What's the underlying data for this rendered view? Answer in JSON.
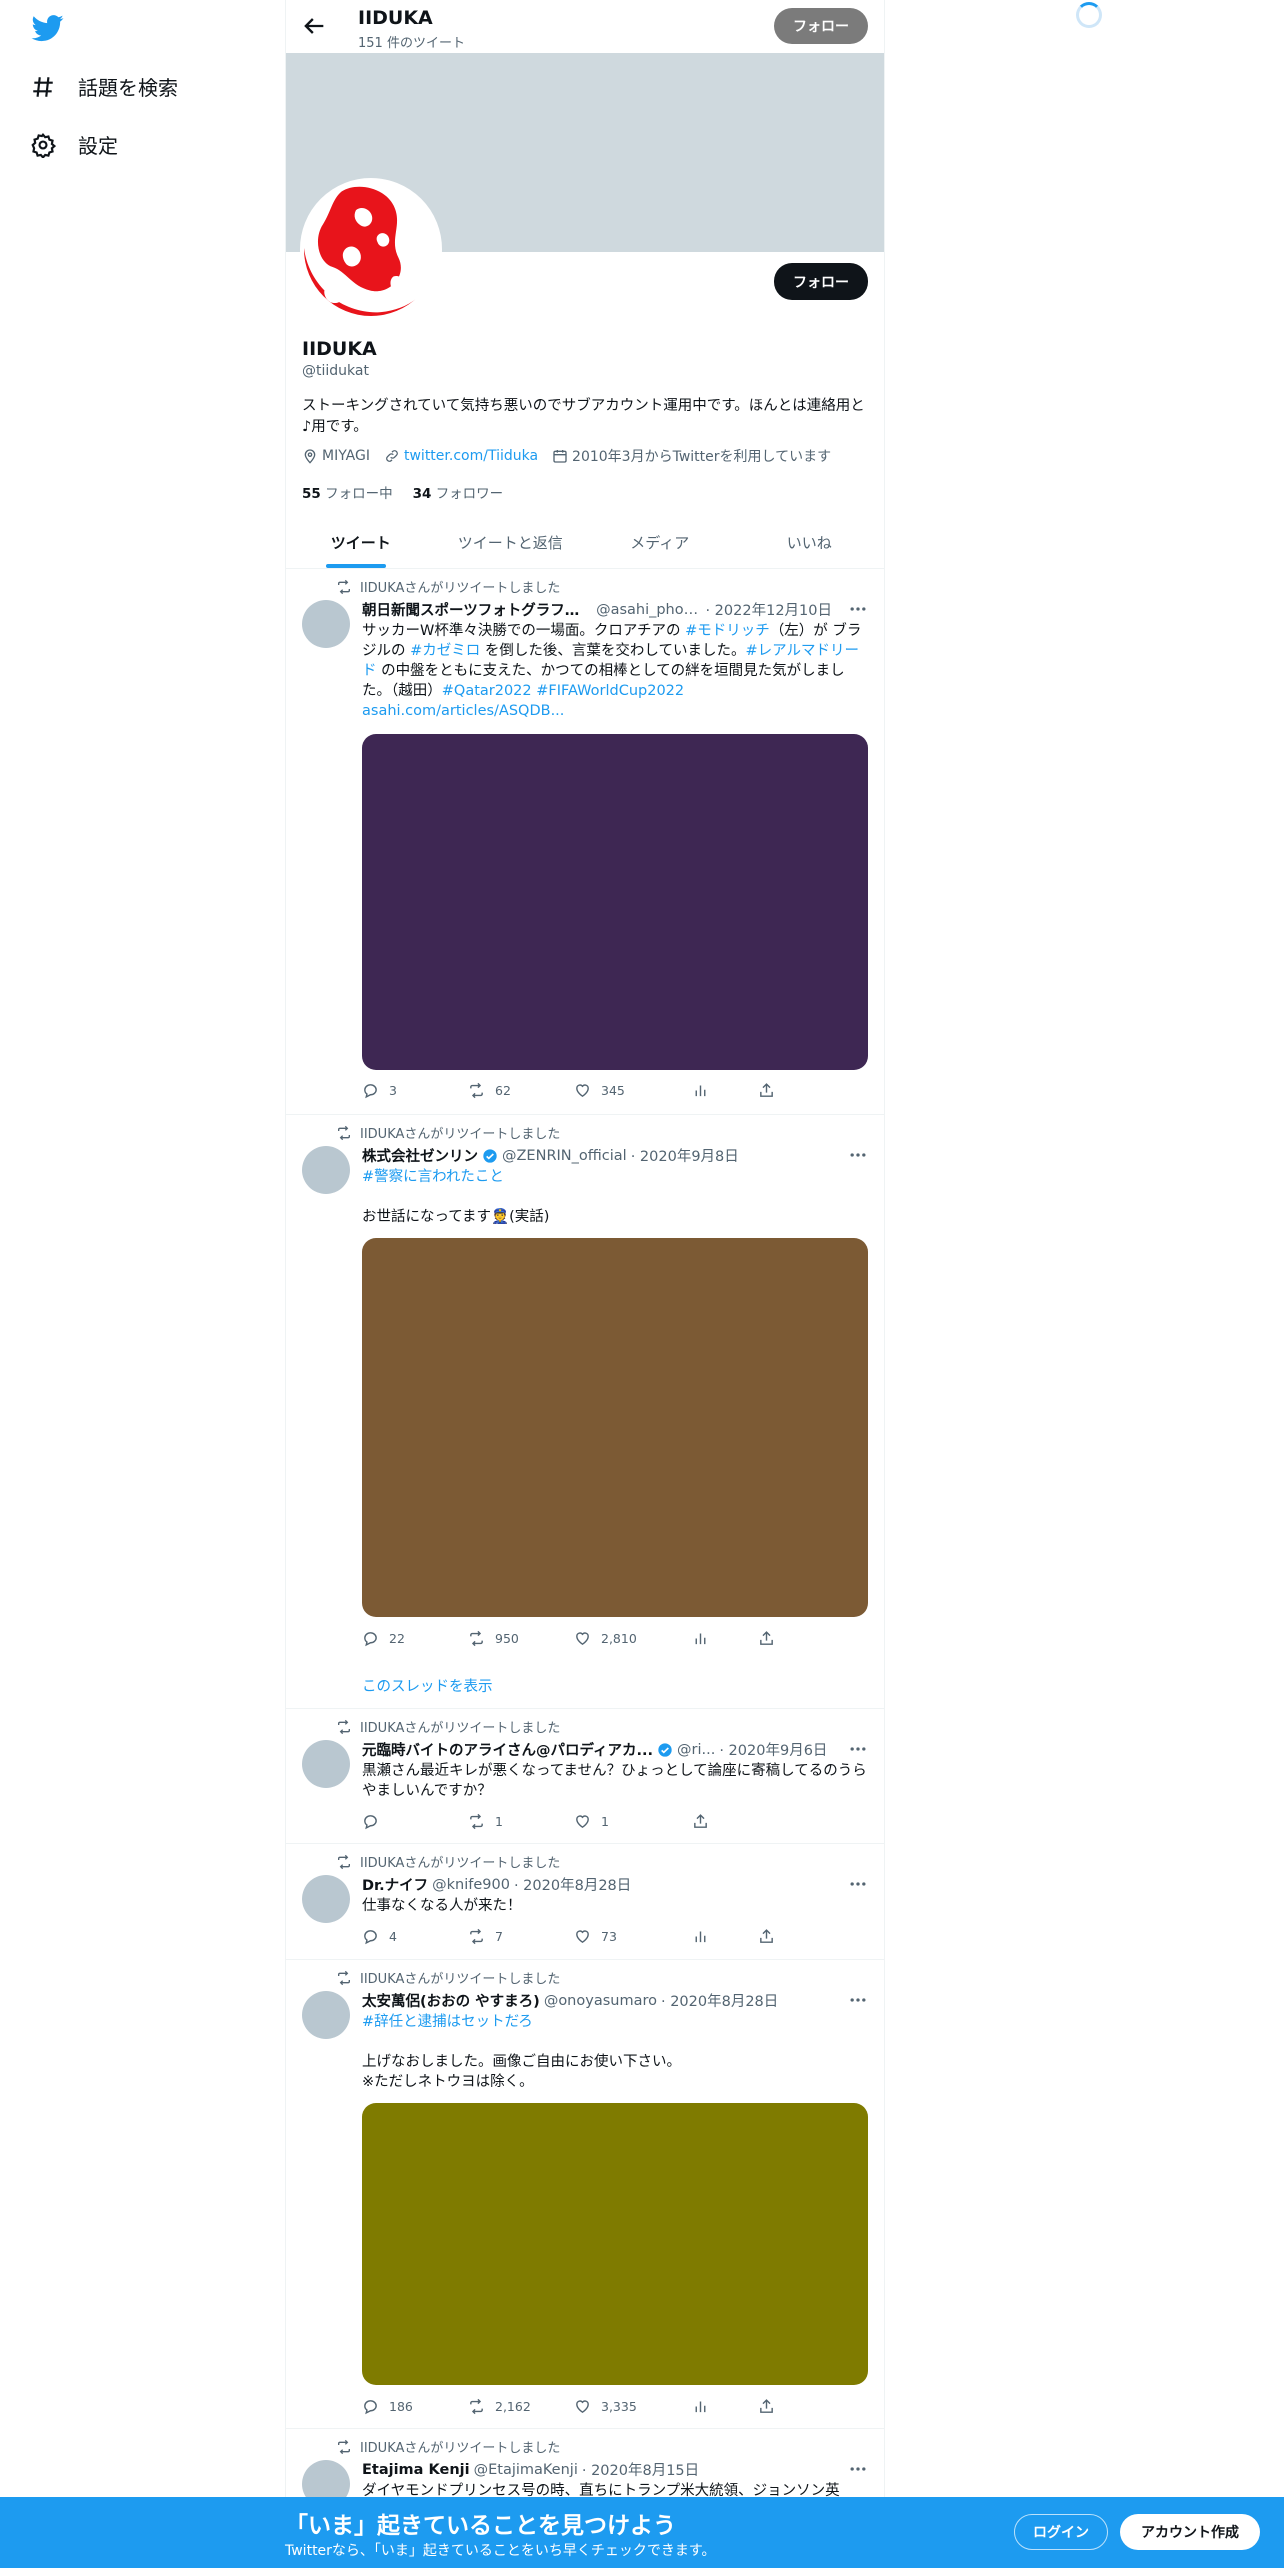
{
  "nav": {
    "explore_label": "話題を検索",
    "settings_label": "設定"
  },
  "topbar": {
    "name": "IIDUKA",
    "tweet_count": "151 件のツイート",
    "follow_label": "フォロー"
  },
  "profile": {
    "follow_label": "フォロー",
    "name": "IIDUKA",
    "handle": "@tiidukat",
    "bio": "ストーキングされていて気持ち悪いのでサブアカウント運用中です。ほんとは連絡用と♪用です。",
    "location": "MIYAGI",
    "link": "twitter.com/Tiiduka",
    "joined": "2010年3月からTwitterを利用しています",
    "following_count": "55",
    "following_label": "フォロー中",
    "followers_count": "34",
    "followers_label": "フォロワー"
  },
  "tabs": [
    {
      "label": "ツイート"
    },
    {
      "label": "ツイートと返信"
    },
    {
      "label": "メディア"
    },
    {
      "label": "いいね"
    }
  ],
  "tweets": [
    {
      "retweet_label": "IIDUKAさんがリツイートしました",
      "name": "朝日新聞スポーツフォトグラファ...",
      "handle": "@asahi_phot...",
      "date": "· 2022年12月10日",
      "body_1": "サッカーW杯準々決勝での一場面。クロアチアの ",
      "tag_1": "#モドリッチ",
      "body_2": "（左）が ブラジルの ",
      "tag_2": "#カゼミロ",
      "body_3": " を倒した後、言葉を交わしていました。",
      "tag_3": "#レアルマドリード",
      "body_4": " の中盤をともに支えた、かつての相棒としての絆を垣間見た気がしました。（越田）",
      "tag_4": "#Qatar2022",
      "tag_5": "#FIFAWorldCup2022",
      "link": "asahi.com/articles/ASQDB...",
      "media_color": "#3e2753",
      "replies": "3",
      "retweets": "62",
      "likes": "345"
    },
    {
      "retweet_label": "IIDUKAさんがリツイートしました",
      "name": "株式会社ゼンリン",
      "handle": "@ZENRIN_official",
      "date": "· 2020年9月8日",
      "tag_1": "#警察に言われたこと",
      "body_1": "お世話になってます👮(実話)",
      "media_color": "#7c5a34",
      "replies": "22",
      "retweets": "950",
      "likes": "2,810",
      "thread_label": "このスレッドを表示"
    },
    {
      "retweet_label": "IIDUKAさんがリツイートしました",
      "name": "元臨時バイトのアライさん@パロディアカ...",
      "handle": "@ri...",
      "date": "· 2020年9月6日",
      "body_1": "黒瀬さん最近キレが悪くなってません？ひょっとして論座に寄稿してるのうらやましいんですか？",
      "replies": "",
      "retweets": "1",
      "likes": "1"
    },
    {
      "retweet_label": "IIDUKAさんがリツイートしました",
      "name": "Dr.ナイフ",
      "handle": "@knife900",
      "date": "· 2020年8月28日",
      "body_1": "仕事なくなる人が来た！",
      "replies": "4",
      "retweets": "7",
      "likes": "73"
    },
    {
      "retweet_label": "IIDUKAさんがリツイートしました",
      "name": "太安萬侶(おおの やすまろ)",
      "handle": "@onoyasumaro",
      "date": "· 2020年8月28日",
      "tag_1": "#辞任と逮捕はセットだろ",
      "body_1": "上げなおしました。画像ご自由にお使い下さい。",
      "body_2": "※ただしネトウヨは除く。",
      "media_color": "#7f7b00",
      "replies": "186",
      "retweets": "2,162",
      "likes": "3,335"
    },
    {
      "retweet_label": "IIDUKAさんがリツイートしました",
      "name": "Etajima Kenji",
      "handle": "@EtajimaKenji",
      "date": "· 2020年8月15日",
      "body_1": "ダイヤモンドプリンセス号の時、直ちにトランプ米大統領、ジョンソン英"
    }
  ],
  "bottom_bar": {
    "title": "「いま」起きていることを見つけよう",
    "subtitle": "Twitterなら、「いま」起きていることをいち早くチェックできます。",
    "login_label": "ログイン",
    "signup_label": "アカウント作成"
  },
  "colors": {
    "accent": "#1d9bf0",
    "banner": "#cfd9de",
    "text": "#0f1419",
    "muted": "#536471"
  }
}
